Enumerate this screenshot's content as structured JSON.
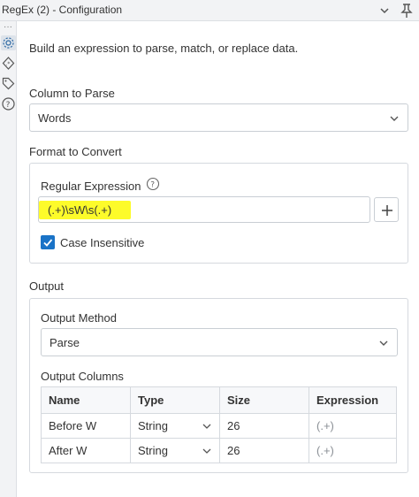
{
  "window": {
    "title": "RegEx (2) - Configuration"
  },
  "description": "Build an expression to parse, match, or replace data.",
  "column_to_parse": {
    "label": "Column to Parse",
    "value": "Words"
  },
  "format_to_convert": {
    "label": "Format to Convert",
    "regex_label": "Regular Expression",
    "regex_value": "(.+)\\sW\\s(.+)",
    "highlight_color": "#fdfb2a",
    "case_insensitive_label": "Case Insensitive",
    "case_insensitive_checked": true,
    "accent_color": "#1a73c7"
  },
  "output": {
    "label": "Output",
    "method_label": "Output Method",
    "method_value": "Parse",
    "columns_label": "Output Columns",
    "columns_headers": [
      "Name",
      "Type",
      "Size",
      "Expression"
    ],
    "rows": [
      {
        "name": "Before W",
        "type": "String",
        "size": "26",
        "expression": "(.+)"
      },
      {
        "name": "After W",
        "type": "String",
        "size": "26",
        "expression": "(.+)"
      }
    ]
  },
  "icons": {
    "rail": [
      "gear-icon",
      "regex-icon",
      "tag-icon",
      "help-icon"
    ],
    "titlebar": [
      "chevron-down-icon",
      "pin-icon"
    ]
  }
}
